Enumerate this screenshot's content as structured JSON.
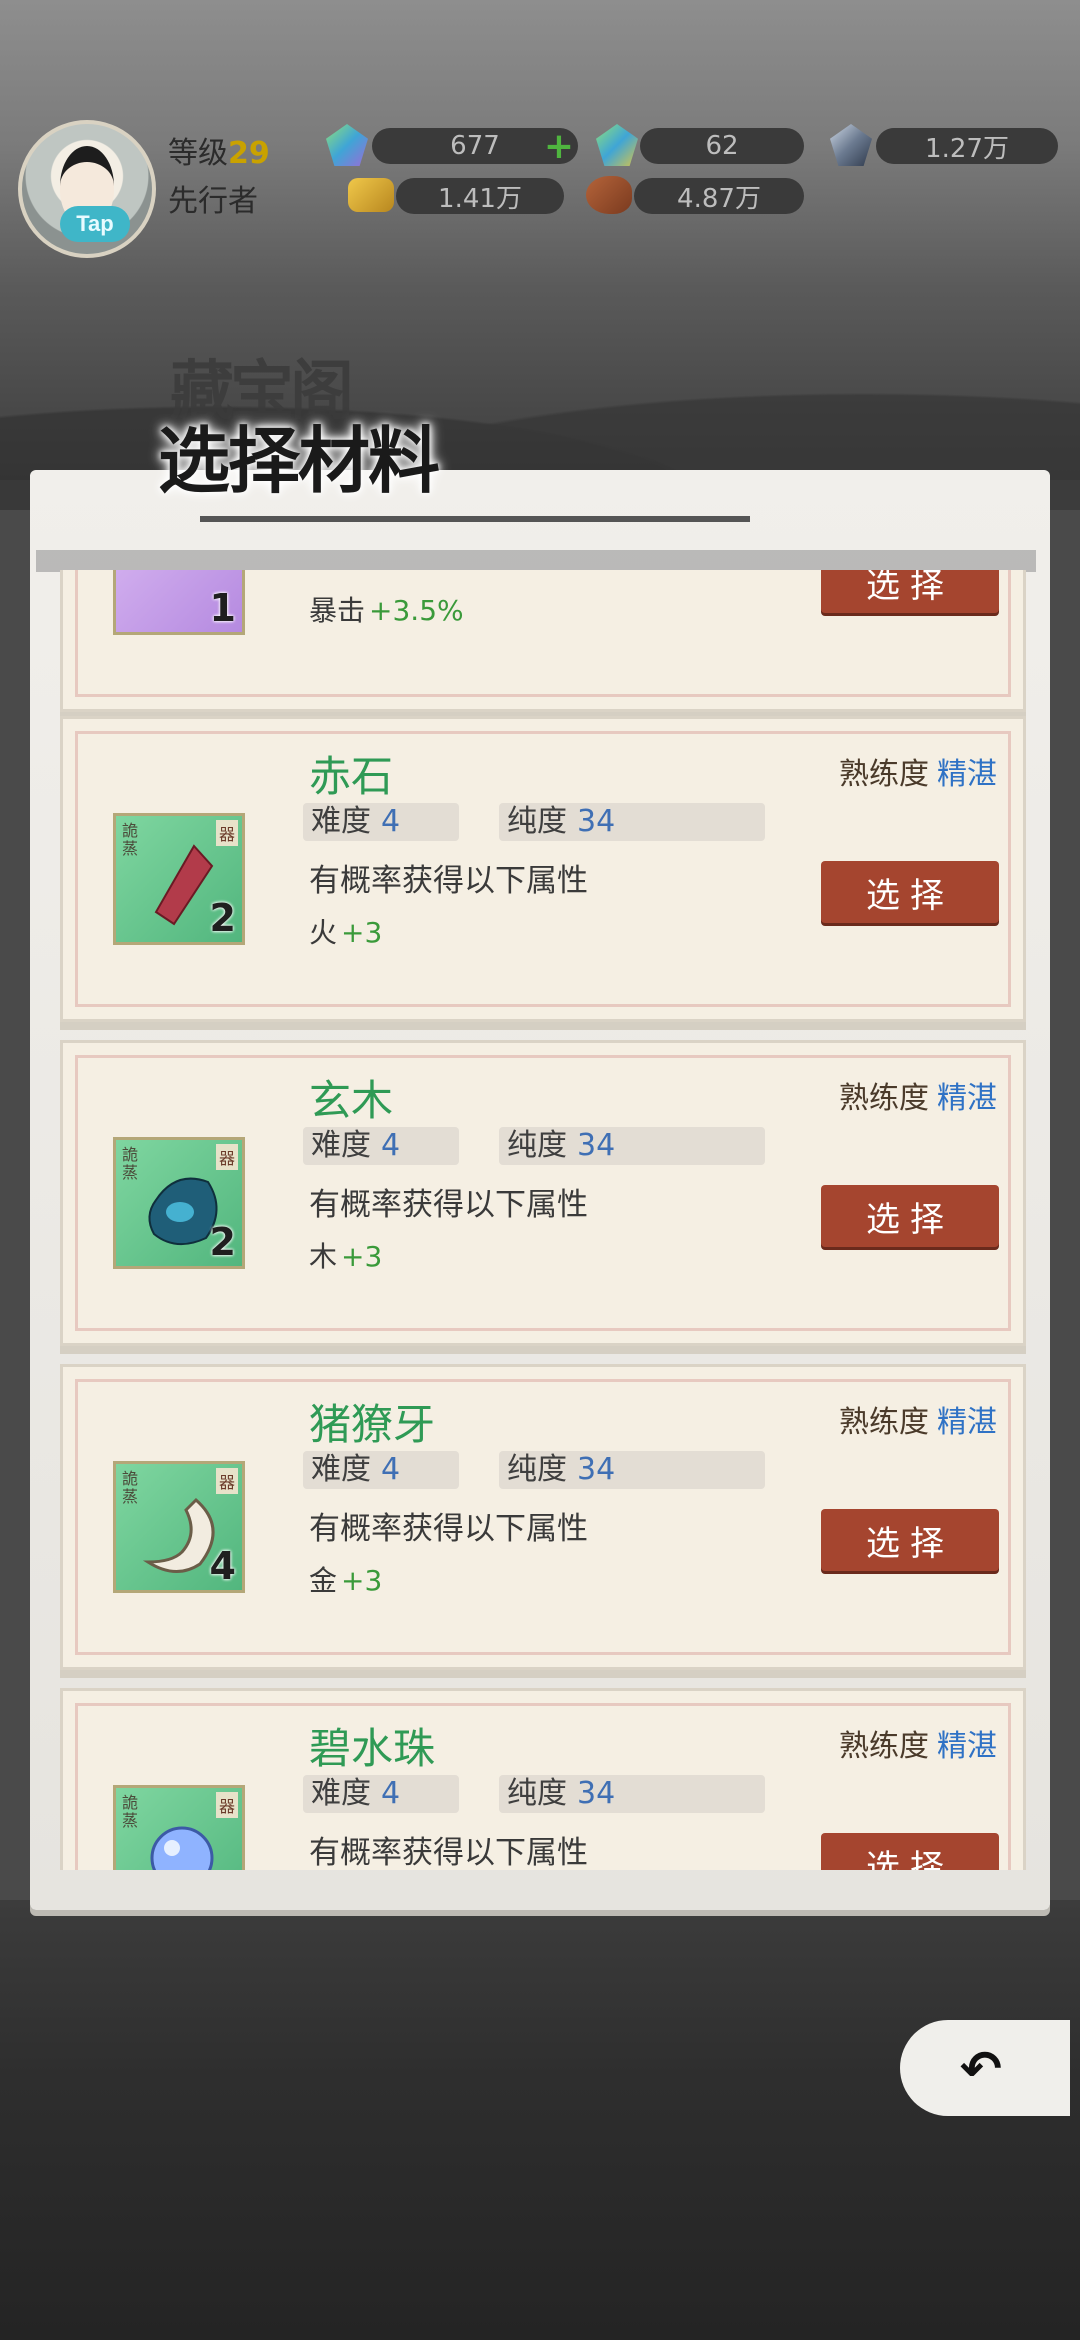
{
  "header": {
    "level_label": "等级",
    "level_value": "29",
    "rank": "先行者",
    "tap_badge": "Tap",
    "resources": [
      {
        "name": "jade-gem",
        "value": "677"
      },
      {
        "name": "spirit-gem",
        "value": "62"
      },
      {
        "name": "ore-crystal",
        "value": "1.27万"
      },
      {
        "name": "gold-ingot",
        "value": "1.41万"
      },
      {
        "name": "meat",
        "value": "4.87万"
      }
    ]
  },
  "title": {
    "ghost": "藏宝阁",
    "main": "选择材料"
  },
  "cards": [
    {
      "name": "",
      "count": "1",
      "attr_label": "暴击",
      "attr_value": "+3.5%",
      "button": "选择"
    },
    {
      "name": "赤石",
      "count": "2",
      "mastery_label": "熟练度",
      "mastery_value": "精湛",
      "difficulty_label": "难度",
      "difficulty_value": "4",
      "purity_label": "纯度",
      "purity_value": "34",
      "probability_text": "有概率获得以下属性",
      "attr_label": "火",
      "attr_value": "+3",
      "button": "选择",
      "tag_left": "詭蒸",
      "tag_right": "器"
    },
    {
      "name": "玄木",
      "count": "2",
      "mastery_label": "熟练度",
      "mastery_value": "精湛",
      "difficulty_label": "难度",
      "difficulty_value": "4",
      "purity_label": "纯度",
      "purity_value": "34",
      "probability_text": "有概率获得以下属性",
      "attr_label": "木",
      "attr_value": "+3",
      "button": "选择",
      "tag_left": "詭蒸",
      "tag_right": "器"
    },
    {
      "name": "猪獠牙",
      "count": "4",
      "mastery_label": "熟练度",
      "mastery_value": "精湛",
      "difficulty_label": "难度",
      "difficulty_value": "4",
      "purity_label": "纯度",
      "purity_value": "34",
      "probability_text": "有概率获得以下属性",
      "attr_label": "金",
      "attr_value": "+3",
      "button": "选择",
      "tag_left": "詭蒸",
      "tag_right": "器"
    },
    {
      "name": "碧水珠",
      "mastery_label": "熟练度",
      "mastery_value": "精湛",
      "difficulty_label": "难度",
      "difficulty_value": "4",
      "purity_label": "纯度",
      "purity_value": "34",
      "probability_text": "有概率获得以下属性",
      "button": "选择",
      "tag_left": "詭蒸",
      "tag_right": "器"
    }
  ],
  "colors": {
    "button": "#a5452f",
    "item_name": "#2f9a55",
    "mastery": "#2f72c5",
    "attr": "#3a9a3a"
  }
}
